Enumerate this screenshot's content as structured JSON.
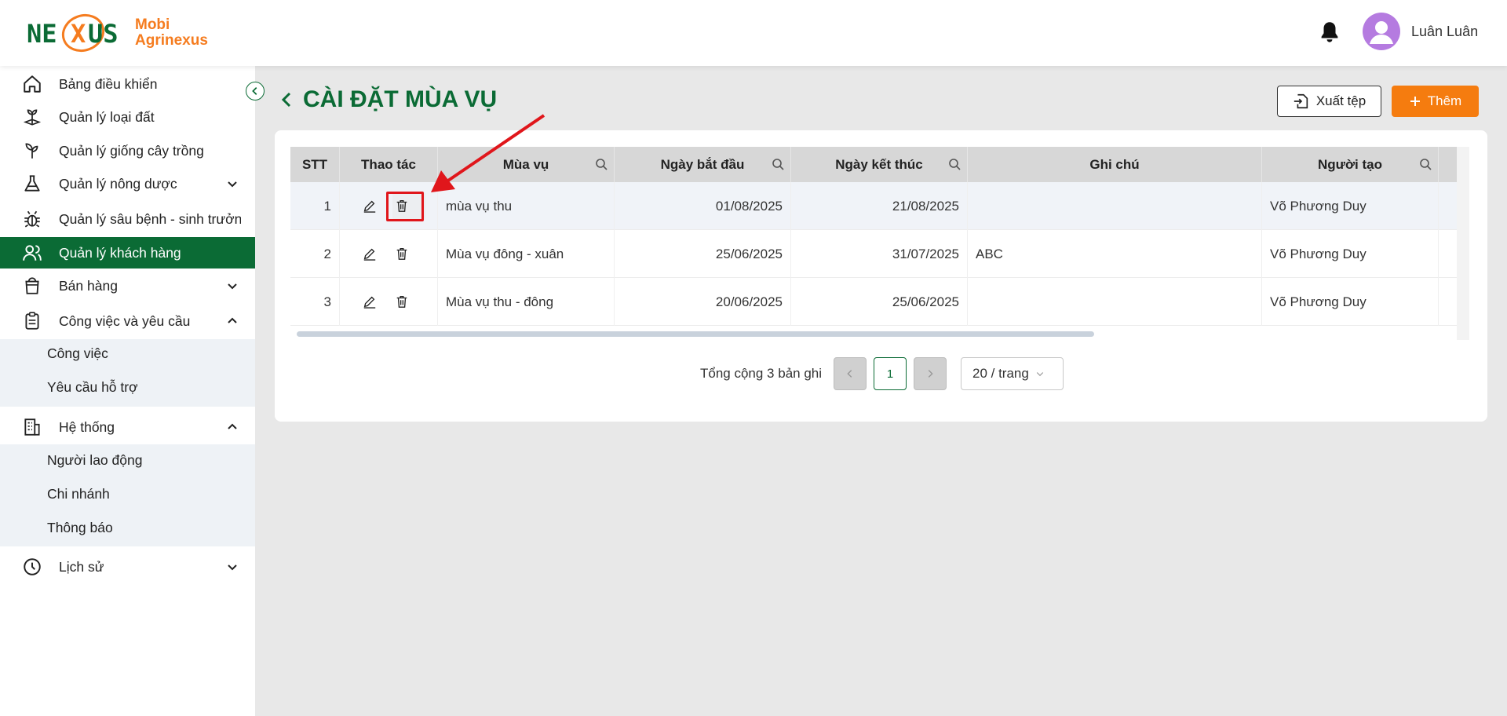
{
  "brand": {
    "line1": "Mobi",
    "line2": "Agrinexus",
    "logo_text": "NEXUS"
  },
  "header": {
    "username": "Luân Luân"
  },
  "sidebar": {
    "items": [
      {
        "label": "Bảng điều khiển",
        "icon": "home-icon"
      },
      {
        "label": "Quản lý loại đất",
        "icon": "soil-icon"
      },
      {
        "label": "Quản lý giống cây trồng",
        "icon": "plant-icon"
      },
      {
        "label": "Quản lý nông dược",
        "icon": "flask-icon"
      },
      {
        "label": "Quản lý sâu bệnh - sinh trưởng",
        "icon": "bug-icon"
      },
      {
        "label": "Quản lý khách hàng",
        "icon": "users-icon"
      },
      {
        "label": "Bán hàng",
        "icon": "bag-icon"
      },
      {
        "label": "Công việc và yêu cầu",
        "icon": "clipboard-icon"
      },
      {
        "label": "Hệ thống",
        "icon": "building-icon"
      },
      {
        "label": "Lịch sử",
        "icon": "clock-icon"
      }
    ],
    "sub_work": [
      "Công việc",
      "Yêu cầu hỗ trợ"
    ],
    "sub_system": [
      "Người lao động",
      "Chi nhánh",
      "Thông báo"
    ]
  },
  "page": {
    "title": "CÀI ĐẶT MÙA VỤ",
    "export_label": "Xuất tệp",
    "add_label": "Thêm"
  },
  "table": {
    "columns": [
      "STT",
      "Thao tác",
      "Mùa vụ",
      "Ngày bắt đầu",
      "Ngày kết thúc",
      "Ghi chú",
      "Người tạo"
    ],
    "rows": [
      {
        "stt": "1",
        "season": "mùa vụ thu",
        "start": "01/08/2025",
        "end": "21/08/2025",
        "note": "",
        "creator": "Võ Phương Duy"
      },
      {
        "stt": "2",
        "season": "Mùa vụ đông - xuân",
        "start": "25/06/2025",
        "end": "31/07/2025",
        "note": "ABC",
        "creator": "Võ Phương Duy"
      },
      {
        "stt": "3",
        "season": "Mùa vụ thu - đông",
        "start": "20/06/2025",
        "end": "25/06/2025",
        "note": "",
        "creator": "Võ Phương Duy"
      }
    ]
  },
  "pagination": {
    "total": "Tổng cộng 3 bản ghi",
    "current": "1",
    "page_size": "20 / trang"
  },
  "colors": {
    "primary": "#0b6b35",
    "accent": "#f57c0f",
    "highlight": "#e0161b"
  }
}
